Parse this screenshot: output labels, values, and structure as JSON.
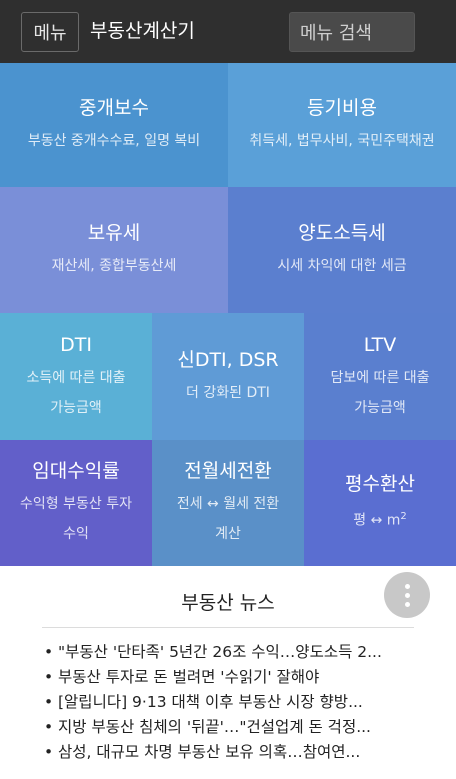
{
  "header": {
    "menu_label": "메뉴",
    "title": "부동산계산기",
    "search_placeholder": "메뉴 검색"
  },
  "tiles": [
    {
      "title": "중개보수",
      "desc": "부동산 중개수수료, 일명 복비",
      "color": "#4b93cf"
    },
    {
      "title": "등기비용",
      "desc": "취득세, 법무사비, 국민주택채권",
      "color": "#5aa0d8"
    },
    {
      "title": "보유세",
      "desc": "재산세, 종합부동산세",
      "color": "#7a8fd8"
    },
    {
      "title": "양도소득세",
      "desc": "시세 차익에 대한 세금",
      "color": "#5b7fcf"
    },
    {
      "title": "DTI",
      "desc": "소득에 따른 대출 가능금액",
      "color": "#5ab0d6"
    },
    {
      "title": "신DTI, DSR",
      "desc": "더 강화된 DTI",
      "color": "#5f9bd6"
    },
    {
      "title": "LTV",
      "desc": "담보에 따른 대출 가능금액",
      "color": "#5a7fcf"
    },
    {
      "title": "임대수익률",
      "desc": "수익형 부동산 투자수익",
      "color": "#625fc9"
    },
    {
      "title": "전월세전환",
      "desc": "전세 ↔ 월세 전환 계산",
      "color": "#5a90c8"
    },
    {
      "title": "평수환산",
      "desc_prefix": "평 ↔ m",
      "desc_sup": "2",
      "color": "#5a6ed1"
    }
  ],
  "news": {
    "title": "부동산 뉴스",
    "bullet": "•",
    "items": [
      "\"부동산 '단타족' 5년간 26조 수익…양도소득 2...",
      "부동산 투자로 돈 벌려면 '수읽기' 잘해야",
      "[알립니다] 9·13 대책 이후 부동산 시장 향방...",
      "지방 부동산 침체의 '뒤끝'…\"건설업계 돈 걱정...",
      "삼성, 대규모 차명 부동산 보유 의혹…참여연..."
    ]
  }
}
